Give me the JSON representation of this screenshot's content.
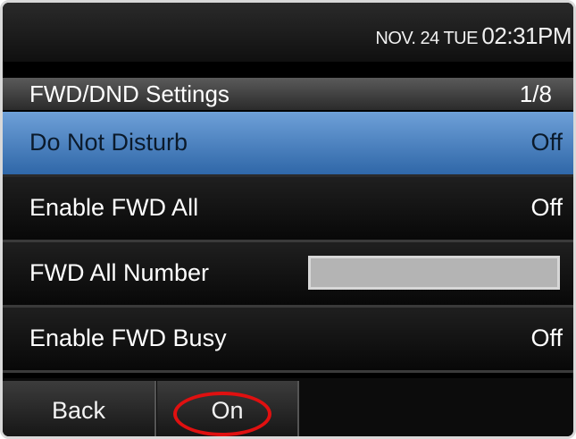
{
  "statusbar": {
    "date": "NOV. 24 TUE",
    "time": "02:31PM"
  },
  "header": {
    "title": "FWD/DND Settings",
    "page": "1/8"
  },
  "rows": [
    {
      "label": "Do Not Disturb",
      "value": "Off"
    },
    {
      "label": "Enable FWD All",
      "value": "Off"
    },
    {
      "label": "FWD All Number",
      "value": ""
    },
    {
      "label": "Enable FWD Busy",
      "value": "Off"
    }
  ],
  "softkeys": {
    "back": "Back",
    "on": "On"
  },
  "colors": {
    "selection_blue": "#4f84c4",
    "annotation_red": "#e01010"
  }
}
